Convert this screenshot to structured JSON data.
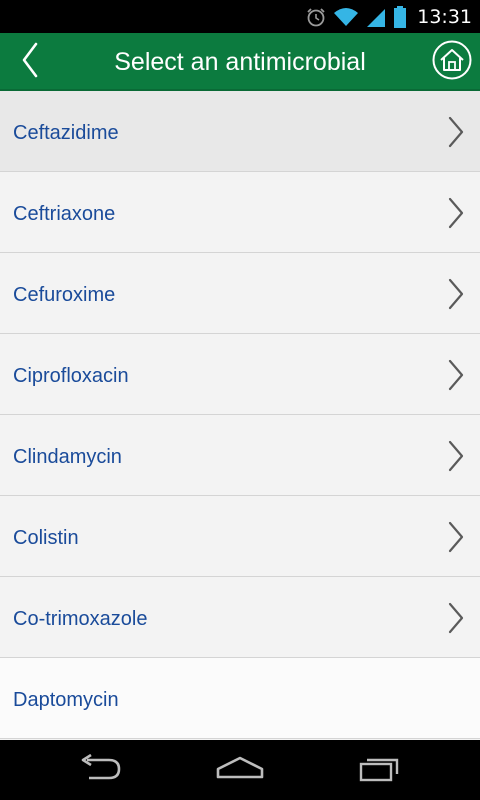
{
  "status_bar": {
    "time": "13:31",
    "icons": [
      "alarm-icon",
      "wifi-icon",
      "signal-icon",
      "battery-icon"
    ]
  },
  "header": {
    "title": "Select an antimicrobial",
    "back_icon": "chevron-left-icon",
    "home_icon": "home-icon",
    "background_color": "#0c7b3f"
  },
  "list": {
    "items": [
      {
        "label": "Ceftazidime",
        "has_chevron": true
      },
      {
        "label": "Ceftriaxone",
        "has_chevron": true
      },
      {
        "label": "Cefuroxime",
        "has_chevron": true
      },
      {
        "label": "Ciprofloxacin",
        "has_chevron": true
      },
      {
        "label": "Clindamycin",
        "has_chevron": true
      },
      {
        "label": "Colistin",
        "has_chevron": true
      },
      {
        "label": "Co-trimoxazole",
        "has_chevron": true
      },
      {
        "label": "Daptomycin",
        "has_chevron": false
      }
    ],
    "label_color": "#1a4b9a"
  },
  "nav_bar": {
    "buttons": [
      "back-icon",
      "home-icon",
      "recents-icon"
    ]
  }
}
